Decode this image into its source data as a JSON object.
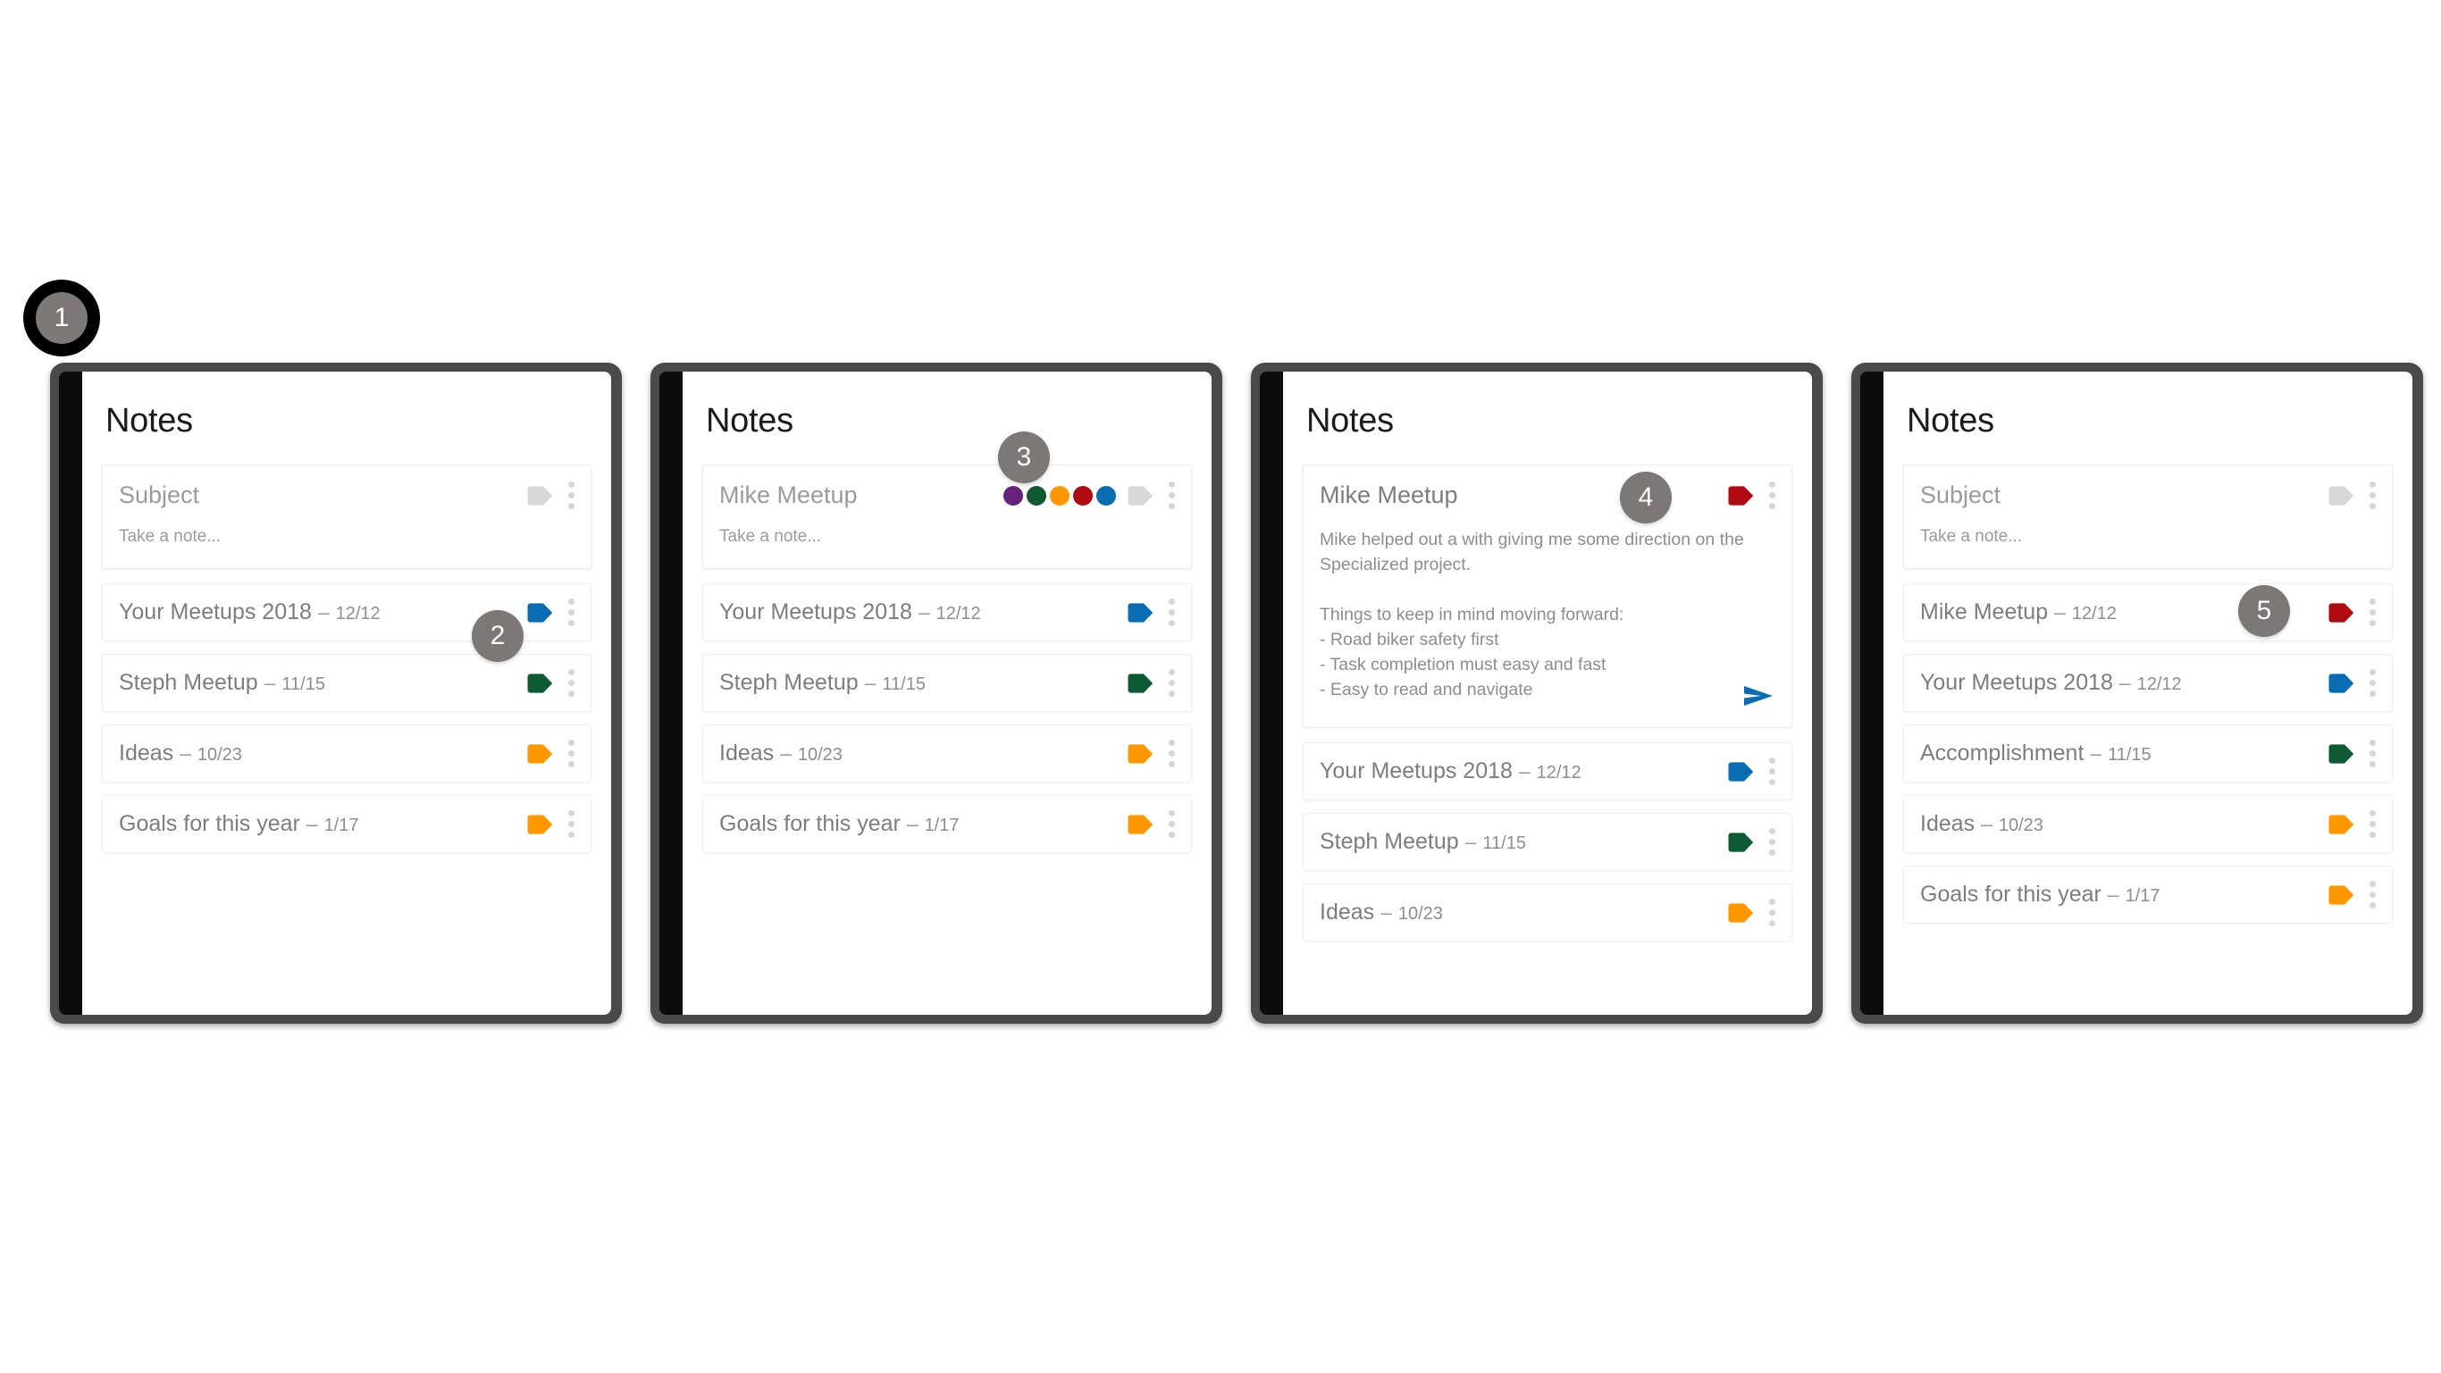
{
  "app": {
    "title": "Notes"
  },
  "colors": {
    "purple": "#66237e",
    "green": "#0e5a34",
    "orange": "#ff9800",
    "red": "#b00b10",
    "blue": "#0a6db3",
    "gray": "#d8d8d8",
    "frame": "#4a4a4a",
    "bezel": "#0c0c0c",
    "badge": "#7d7875"
  },
  "compose": {
    "subject_placeholder": "Subject",
    "body_placeholder": "Take a note...",
    "filled_subject": "Mike Meetup"
  },
  "detail": {
    "title": "Mike Meetup",
    "tag_color": "red",
    "body": "Mike helped out a with giving me some direction on the Specialized project.\n\nThings to keep in mind moving forward:\n- Road biker safety first\n- Task completion must easy and fast\n- Easy to read and navigate",
    "send_label": "send-note"
  },
  "swatches": [
    {
      "name": "purple",
      "hex": "#66237e"
    },
    {
      "name": "green",
      "hex": "#0e5a34"
    },
    {
      "name": "orange",
      "hex": "#ff9800"
    },
    {
      "name": "red",
      "hex": "#b00b10"
    },
    {
      "name": "blue",
      "hex": "#0a6db3"
    }
  ],
  "panels": [
    {
      "id": "panel-1",
      "badge": "1",
      "state": "empty-compose",
      "compose": {
        "subject": "Subject",
        "subject_is_placeholder": true,
        "body": "Take a note...",
        "tag_color": "gray",
        "show_swatches": false
      },
      "notes": [
        {
          "title": "Your Meetups 2018",
          "date": "12/12",
          "tag_color": "blue"
        },
        {
          "title": "Steph Meetup",
          "date": "11/15",
          "tag_color": "green"
        },
        {
          "title": "Ideas",
          "date": "10/23",
          "tag_color": "orange"
        },
        {
          "title": "Goals for this year",
          "date": "1/17",
          "tag_color": "orange"
        }
      ]
    },
    {
      "id": "panel-2",
      "badge": "3",
      "state": "compose-with-color-picker",
      "compose": {
        "subject": "Mike Meetup",
        "subject_is_placeholder": false,
        "body": "Take a note...",
        "tag_color": "gray",
        "show_swatches": true
      },
      "notes": [
        {
          "title": "Your Meetups 2018",
          "date": "12/12",
          "tag_color": "blue"
        },
        {
          "title": "Steph Meetup",
          "date": "11/15",
          "tag_color": "green"
        },
        {
          "title": "Ideas",
          "date": "10/23",
          "tag_color": "orange"
        },
        {
          "title": "Goals for this year",
          "date": "1/17",
          "tag_color": "orange"
        }
      ]
    },
    {
      "id": "panel-3",
      "badge": "4",
      "state": "note-detail",
      "notes": [
        {
          "title": "Your Meetups 2018",
          "date": "12/12",
          "tag_color": "blue"
        },
        {
          "title": "Steph Meetup",
          "date": "11/15",
          "tag_color": "green"
        },
        {
          "title": "Ideas",
          "date": "10/23",
          "tag_color": "orange",
          "clipped": true
        }
      ]
    },
    {
      "id": "panel-4",
      "badge": "5",
      "state": "saved-list",
      "compose": {
        "subject": "Subject",
        "subject_is_placeholder": true,
        "body": "Take a note...",
        "tag_color": "gray",
        "show_swatches": false
      },
      "notes": [
        {
          "title": "Mike Meetup",
          "date": "12/12",
          "tag_color": "red"
        },
        {
          "title": "Your Meetups 2018",
          "date": "12/12",
          "tag_color": "blue"
        },
        {
          "title": "Accomplishment",
          "date": "11/15",
          "tag_color": "green"
        },
        {
          "title": "Ideas",
          "date": "10/23",
          "tag_color": "orange"
        },
        {
          "title": "Goals for this year",
          "date": "1/17",
          "tag_color": "orange"
        }
      ]
    }
  ]
}
